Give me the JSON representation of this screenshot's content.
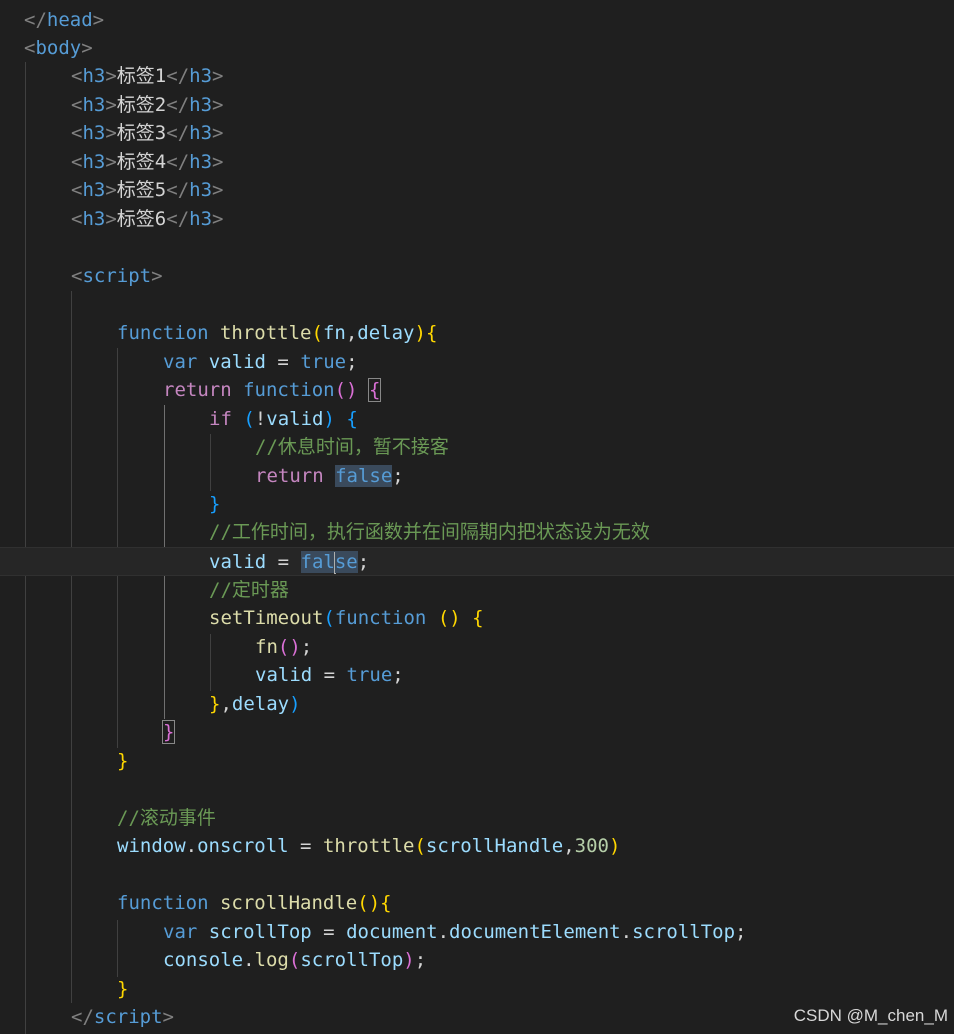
{
  "code": {
    "h3_tag": "h3",
    "head_tag": "head",
    "body_tag": "body",
    "script_tag": "script",
    "headings": [
      "标签1",
      "标签2",
      "标签3",
      "标签4",
      "标签5",
      "标签6"
    ],
    "kw_function": "function",
    "kw_var": "var",
    "kw_return": "return",
    "kw_if": "if",
    "fn_throttle": "throttle",
    "param_fn": "fn",
    "param_delay": "delay",
    "var_valid": "valid",
    "val_true": "true",
    "val_false": "false",
    "comment_rest": "//休息时间，暂不接客",
    "comment_work": "//工作时间，执行函数并在间隔期内把状态设为无效",
    "comment_timer": "//定时器",
    "fn_setTimeout": "setTimeout",
    "comment_scroll": "//滚动事件",
    "obj_window": "window",
    "prop_onscroll": "onscroll",
    "fn_scrollHandle": "scrollHandle",
    "num_300": "300",
    "var_scrollTop": "scrollTop",
    "obj_document": "document",
    "prop_documentElement": "documentElement",
    "prop_scrollTop": "scrollTop",
    "obj_console": "console",
    "fn_log": "log"
  },
  "watermark": "CSDN @M_chen_M"
}
